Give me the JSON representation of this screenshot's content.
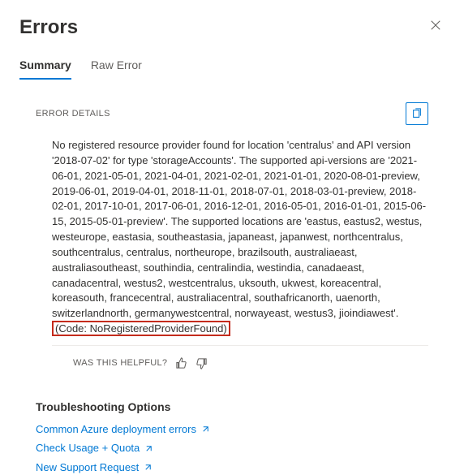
{
  "header": {
    "title": "Errors"
  },
  "tabs": {
    "summary": "Summary",
    "raw_error": "Raw Error"
  },
  "details": {
    "section_title": "ERROR DETAILS",
    "message": "No registered resource provider found for location 'centralus' and API version '2018-07-02' for type 'storageAccounts'. The supported api-versions are '2021-06-01, 2021-05-01, 2021-04-01, 2021-02-01, 2021-01-01, 2020-08-01-preview, 2019-06-01, 2019-04-01, 2018-11-01, 2018-07-01, 2018-03-01-preview, 2018-02-01, 2017-10-01, 2017-06-01, 2016-12-01, 2016-05-01, 2016-01-01, 2015-06-15, 2015-05-01-preview'. The supported locations are 'eastus, eastus2, westus, westeurope, eastasia, southeastasia, japaneast, japanwest, northcentralus, southcentralus, centralus, northeurope, brazilsouth, australiaeast, australiasoutheast, southindia, centralindia, westindia, canadaeast, canadacentral, westus2, westcentralus, uksouth, ukwest, koreacentral, koreasouth, francecentral, australiacentral, southafricanorth, uaenorth, switzerlandnorth, germanywestcentral, norwayeast, westus3, jioindiawest'. ",
    "code": "(Code: NoRegisteredProviderFound)"
  },
  "feedback": {
    "label": "WAS THIS HELPFUL?"
  },
  "troubleshooting": {
    "title": "Troubleshooting Options",
    "links": {
      "common_errors": "Common Azure deployment errors",
      "usage_quota": "Check Usage + Quota",
      "support_request": "New Support Request"
    }
  }
}
